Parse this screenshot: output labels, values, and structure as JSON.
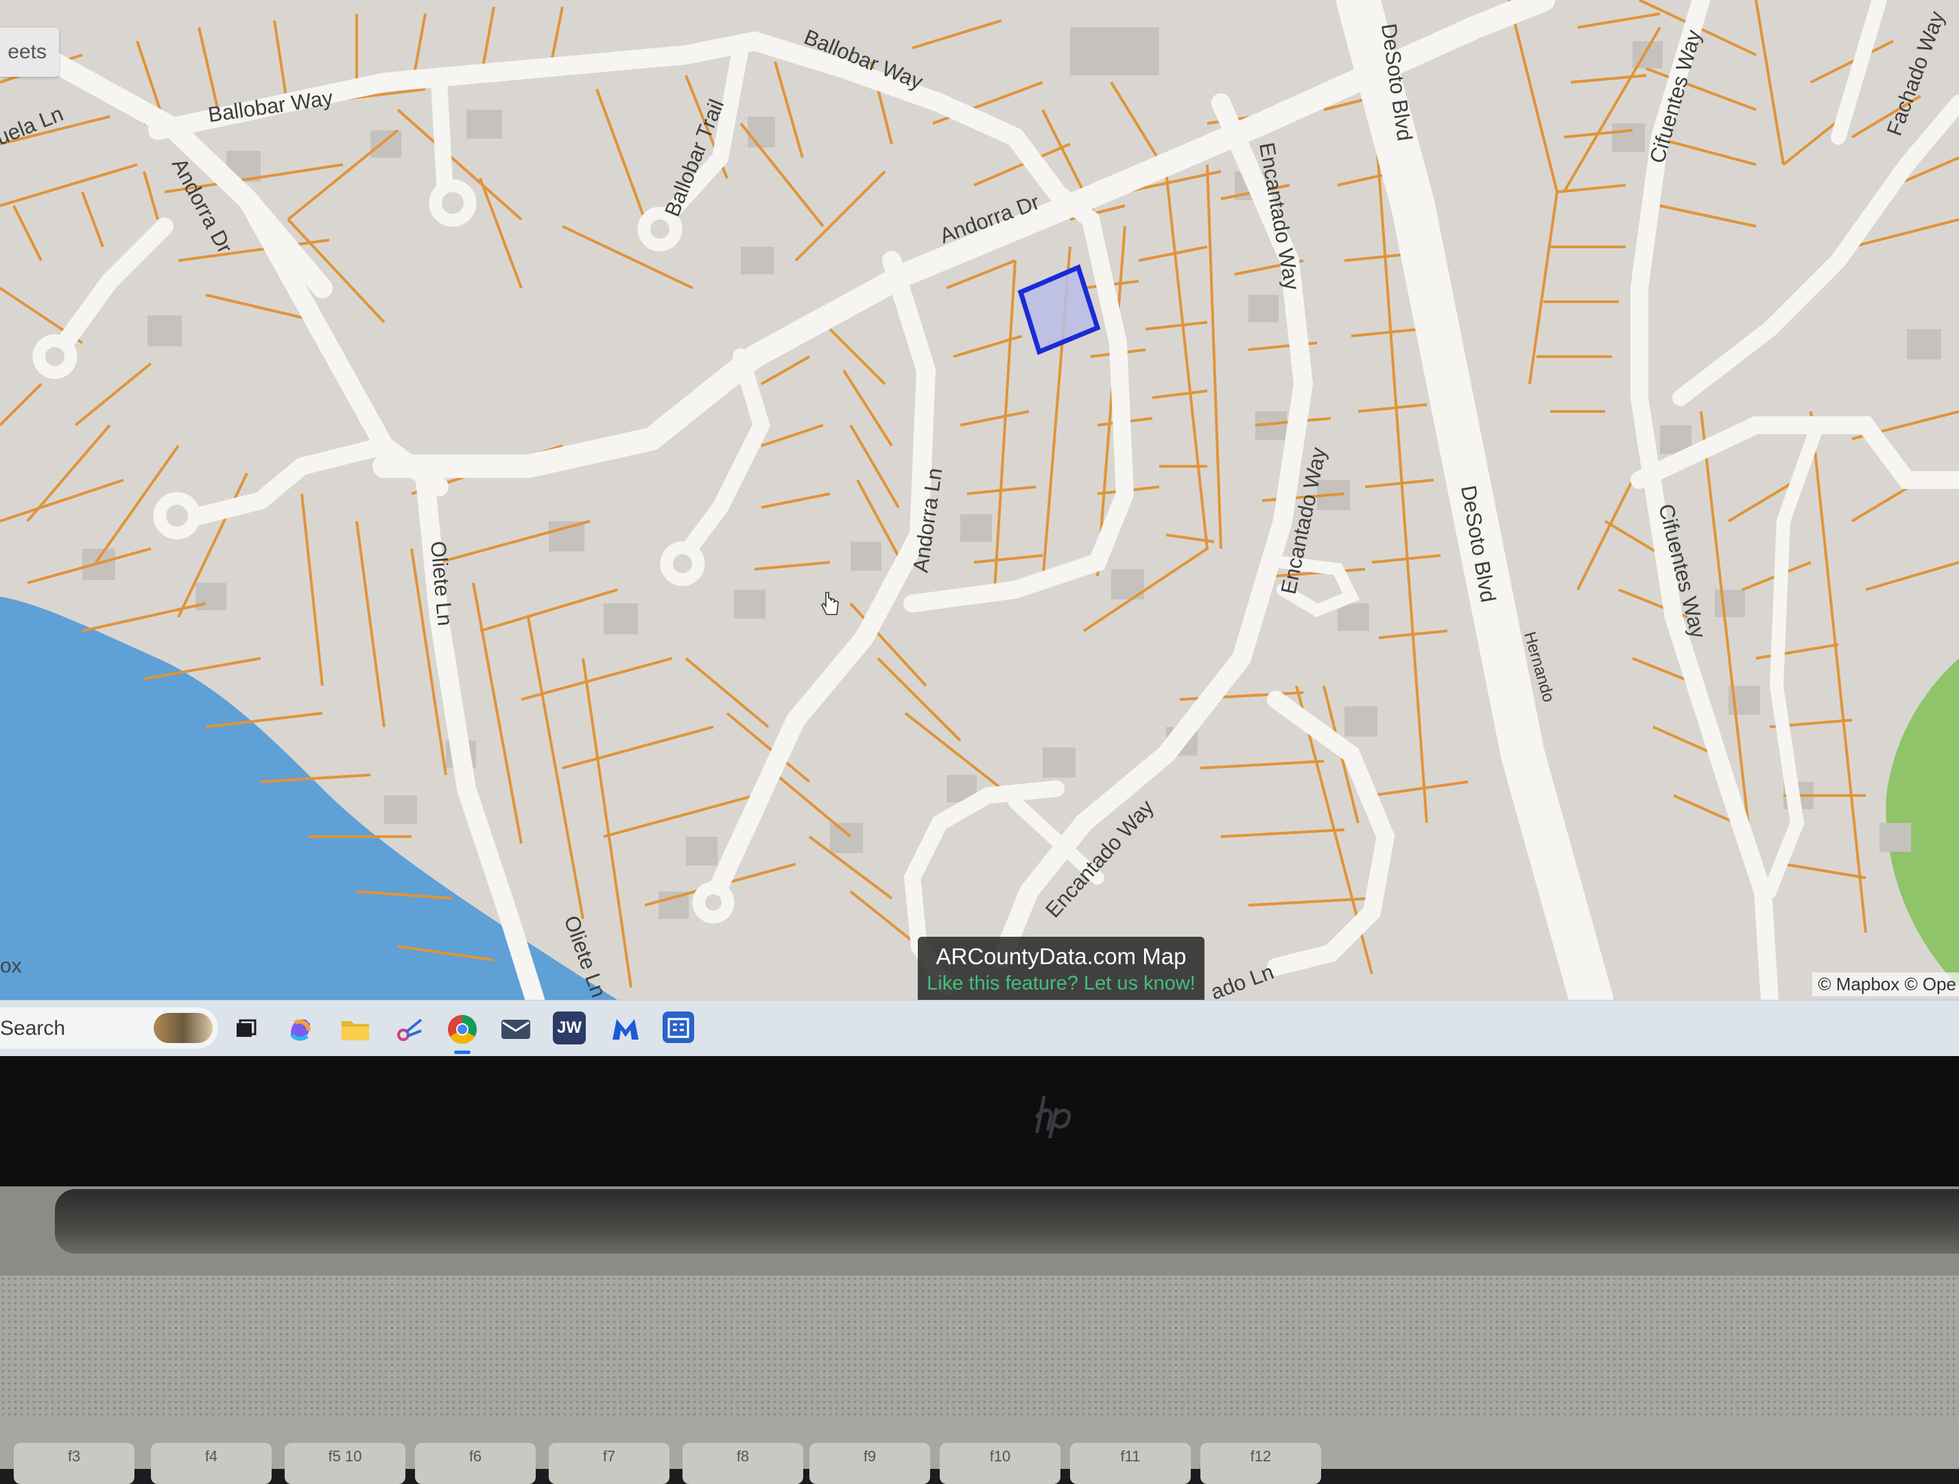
{
  "map": {
    "layer_button_label": "eets",
    "left_edge_label": "ox",
    "attribution": "© Mapbox © Ope",
    "streets": {
      "ballobar_way_west": "Ballobar Way",
      "ballobar_way_east": "Ballobar Way",
      "ballobar_trail": "Ballobar Trail",
      "andorra_dr_north": "Andorra Dr",
      "andorra_dr_west": "Andorra Dr",
      "andorra_ln": "Andorra Ln",
      "oliete_ln_north": "Oliete Ln",
      "oliete_ln_south": "Oliete Ln",
      "encantado_way_north": "Encantado Way",
      "encantado_way_mid": "Encantado Way",
      "encantado_way_south": "Encantado Way",
      "desoto_blvd_north": "DeSoto Blvd",
      "desoto_blvd_south": "DeSoto Blvd",
      "cifuentes_way_north": "Cifuentes Way",
      "cifuentes_way_south": "Cifuentes Way",
      "fachado_way": "Fachado Way",
      "hernando": "Hernando",
      "uela_ln": "uela Ln",
      "ado_ln": "ado Ln"
    },
    "banner": {
      "title": "ARCountyData.com Map",
      "subtitle": "Like this feature? Let us know!"
    },
    "colors": {
      "parcel_line": "#e0943a",
      "road": "#f6f5f2",
      "land": "#d9d6d1",
      "water": "#5fa0d6",
      "park": "#8fc46a",
      "selected_parcel_stroke": "#1a2bd6",
      "selected_parcel_fill": "#b9bde8"
    }
  },
  "taskbar": {
    "search_label": "Search",
    "icons": [
      {
        "name": "task-view-icon"
      },
      {
        "name": "copilot-icon"
      },
      {
        "name": "file-explorer-icon"
      },
      {
        "name": "snipping-tool-icon"
      },
      {
        "name": "chrome-icon",
        "active": true
      },
      {
        "name": "mail-app-icon"
      },
      {
        "name": "jw-app-icon",
        "label": "JW"
      },
      {
        "name": "malwarebytes-icon"
      },
      {
        "name": "calendar-app-icon"
      }
    ]
  },
  "device": {
    "keys": [
      "f3",
      "f4",
      "f5 10",
      "f6",
      "f7",
      "f8",
      "f9",
      "f10",
      "f11",
      "f12"
    ]
  }
}
